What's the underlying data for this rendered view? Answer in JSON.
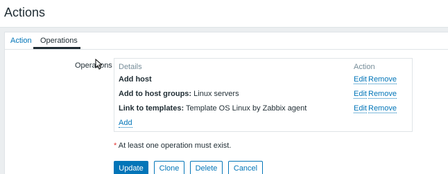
{
  "page": {
    "title": "Actions"
  },
  "tabs": [
    {
      "label": "Action",
      "active": false
    },
    {
      "label": "Operations",
      "active": true
    }
  ],
  "form": {
    "operations_label": "Operations",
    "columns": {
      "details": "Details",
      "action": "Action"
    },
    "rows": [
      {
        "label": "Add host",
        "value": "",
        "edit": "Edit",
        "remove": "Remove"
      },
      {
        "label": "Add to host groups:",
        "value": "Linux servers",
        "edit": "Edit",
        "remove": "Remove"
      },
      {
        "label": "Link to templates:",
        "value": "Template OS Linux by Zabbix agent",
        "edit": "Edit",
        "remove": "Remove"
      }
    ],
    "add_link": "Add",
    "warning_star": "*",
    "warning_text": "At least one operation must exist."
  },
  "buttons": {
    "update": "Update",
    "clone": "Clone",
    "delete": "Delete",
    "cancel": "Cancel"
  },
  "colors": {
    "accent": "#0275b8",
    "background": "#ebeef0",
    "required": "#e33734"
  }
}
